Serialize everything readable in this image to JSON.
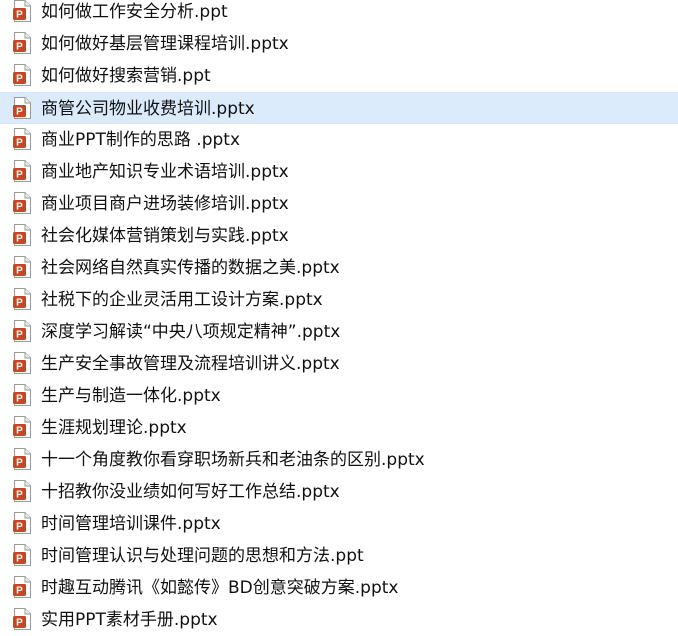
{
  "icon_type": "powerpoint-file-icon",
  "colors": {
    "accent": "#c8461f",
    "selection": "#dcebfb"
  },
  "files": [
    {
      "name": "如何做工作安全分析.ppt",
      "selected": false
    },
    {
      "name": "如何做好基层管理课程培训.pptx",
      "selected": false
    },
    {
      "name": "如何做好搜索营销.ppt",
      "selected": false
    },
    {
      "name": "商管公司物业收费培训.pptx",
      "selected": true
    },
    {
      "name": "商业PPT制作的思路 .pptx",
      "selected": false
    },
    {
      "name": "商业地产知识专业术语培训.pptx",
      "selected": false
    },
    {
      "name": "商业项目商户进场装修培训.pptx",
      "selected": false
    },
    {
      "name": "社会化媒体营销策划与实践.pptx",
      "selected": false
    },
    {
      "name": "社会网络自然真实传播的数据之美.pptx",
      "selected": false
    },
    {
      "name": "社税下的企业灵活用工设计方案.pptx",
      "selected": false
    },
    {
      "name": "深度学习解读“中央八项规定精神”.pptx",
      "selected": false
    },
    {
      "name": "生产安全事故管理及流程培训讲义.pptx",
      "selected": false
    },
    {
      "name": "生产与制造一体化.pptx",
      "selected": false
    },
    {
      "name": "生涯规划理论.pptx",
      "selected": false
    },
    {
      "name": "十一个角度教你看穿职场新兵和老油条的区别.pptx",
      "selected": false
    },
    {
      "name": "十招教你没业绩如何写好工作总结.pptx",
      "selected": false
    },
    {
      "name": "时间管理培训课件.pptx",
      "selected": false
    },
    {
      "name": "时间管理认识与处理问题的思想和方法.ppt",
      "selected": false
    },
    {
      "name": "时趣互动腾讯《如懿传》BD创意突破方案.pptx",
      "selected": false
    },
    {
      "name": "实用PPT素材手册.pptx",
      "selected": false
    }
  ]
}
